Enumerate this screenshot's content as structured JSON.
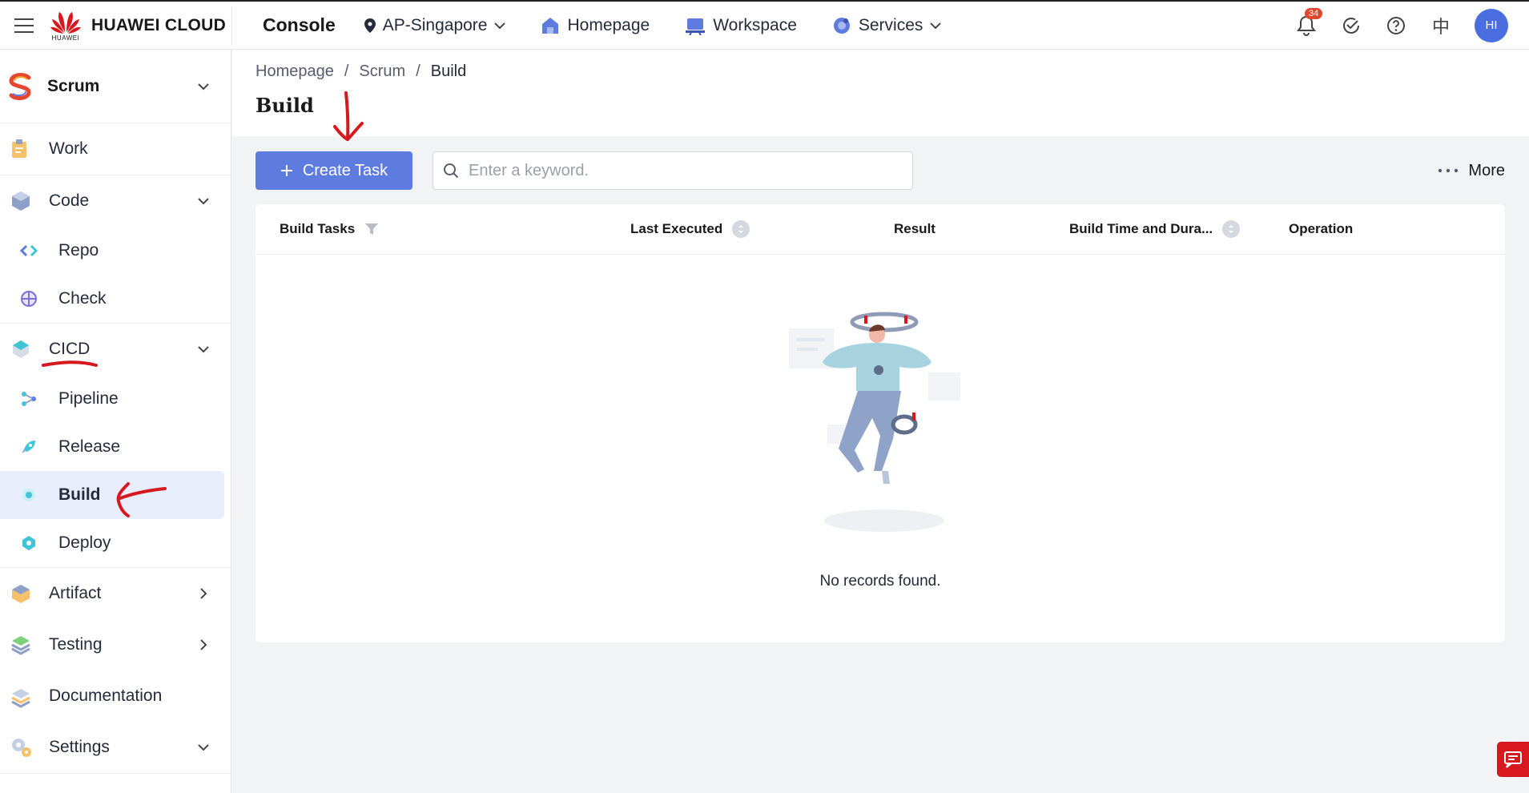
{
  "topbar": {
    "brand_small": "HUAWEI",
    "brand": "HUAWEI CLOUD",
    "console": "Console",
    "region": "AP-Singapore",
    "homepage": "Homepage",
    "workspace": "Workspace",
    "services": "Services",
    "notification_count": "34",
    "language": "中",
    "avatar_initials": "HI"
  },
  "sidebar": {
    "project": "Scrum",
    "work": "Work",
    "code": "Code",
    "repo": "Repo",
    "check": "Check",
    "cicd": "CICD",
    "pipeline": "Pipeline",
    "release": "Release",
    "build": "Build",
    "deploy": "Deploy",
    "artifact": "Artifact",
    "testing": "Testing",
    "documentation": "Documentation",
    "settings": "Settings"
  },
  "breadcrumb": {
    "home": "Homepage",
    "project": "Scrum",
    "current": "Build",
    "sep": "/"
  },
  "page_title": "Build",
  "toolbar": {
    "create_label": "Create Task",
    "search_placeholder": "Enter a keyword.",
    "more_label": "More"
  },
  "table": {
    "columns": [
      "Build Tasks",
      "Last Executed",
      "Result",
      "Build Time and Dura...",
      "Operation"
    ],
    "empty_text": "No records found."
  },
  "colors": {
    "primary": "#5e7ce0",
    "annotation": "#d7191f",
    "badge": "#e6462f"
  }
}
